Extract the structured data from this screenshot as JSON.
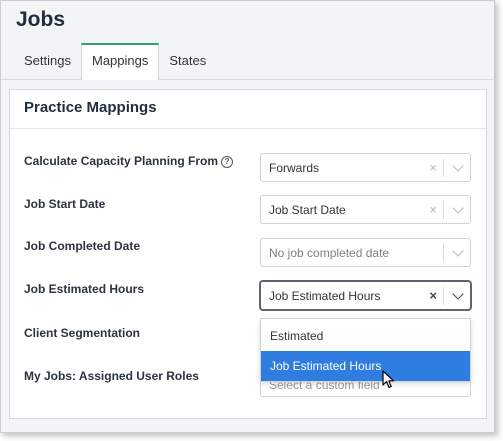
{
  "page": {
    "title": "Jobs"
  },
  "tabs": [
    {
      "label": "Settings",
      "active": false
    },
    {
      "label": "Mappings",
      "active": true
    },
    {
      "label": "States",
      "active": false
    }
  ],
  "panel": {
    "title": "Practice Mappings",
    "rows": [
      {
        "label": "Calculate Capacity Planning From",
        "value": "Forwards",
        "help_icon": "help-circle-icon"
      },
      {
        "label": "Job Start Date",
        "value": "Job Start Date"
      },
      {
        "label": "Job Completed Date",
        "placeholder": "No job completed date"
      },
      {
        "label": "Job Estimated Hours",
        "value": "Job Estimated Hours"
      },
      {
        "label": "Client Segmentation"
      },
      {
        "label": "My Jobs: Assigned User Roles",
        "value": "Select a custom field"
      }
    ],
    "dropdown_options": [
      {
        "label": "Estimated",
        "selected": false
      },
      {
        "label": "Job Estimated Hours",
        "selected": true
      }
    ]
  },
  "icons": {
    "clear": "×",
    "help": "?"
  },
  "colors": {
    "accent_tab": "#2fa36b",
    "selected_option": "#2f7de1"
  }
}
